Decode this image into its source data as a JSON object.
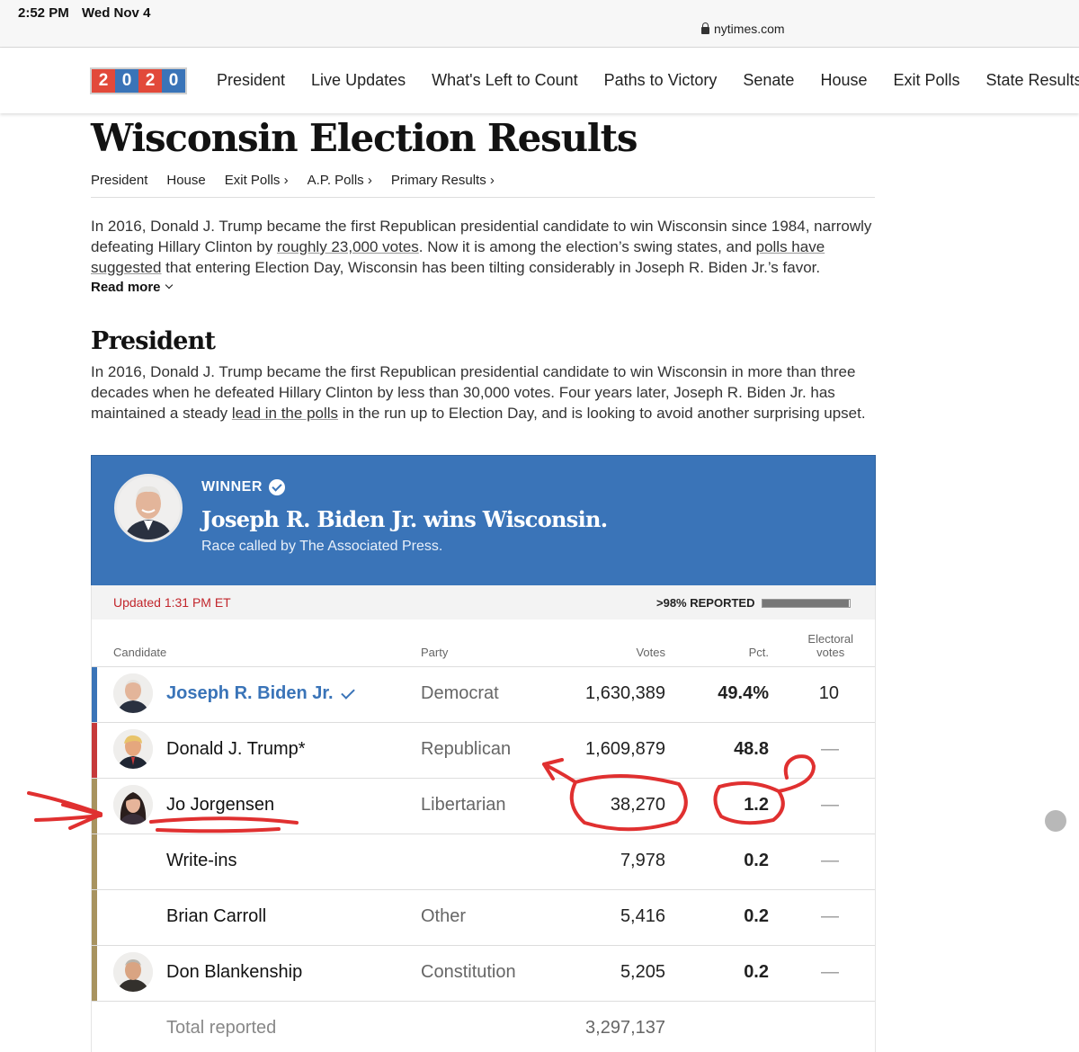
{
  "status": {
    "time": "2:52 PM",
    "date": "Wed Nov 4",
    "url": "nytimes.com"
  },
  "nav": {
    "logo": [
      "2",
      "0",
      "2",
      "0"
    ],
    "items": [
      "President",
      "Live Updates",
      "What's Left to Count",
      "Paths to Victory",
      "Senate",
      "House",
      "Exit Polls",
      "State Results"
    ]
  },
  "page": {
    "title": "Wisconsin Election Results",
    "subnav": [
      "President",
      "House",
      "Exit Polls ›",
      "A.P. Polls ›",
      "Primary Results ›"
    ],
    "intro": {
      "t1": "In 2016, Donald J. Trump became the first Republican presidential candidate to win Wisconsin since 1984, narrowly defeating Hillary Clinton by ",
      "link1": "roughly 23,000 votes",
      "t2": ". Now it is among the election’s swing states, and ",
      "link2": "polls have suggested",
      "t3": " that entering Election Day, Wisconsin has been tilting considerably in Joseph R. Biden Jr.’s favor."
    },
    "read_more": "Read more",
    "section_title": "President",
    "section_desc": {
      "t1": "In 2016, Donald J. Trump became the first Republican presidential candidate to win Wisconsin in more than three decades when he defeated Hillary Clinton by less than 30,000 votes. Four years later, Joseph R. Biden Jr. has maintained a steady ",
      "link": "lead in the polls",
      "t2": " in the run up to Election Day, and is looking to avoid another surprising upset."
    }
  },
  "winner": {
    "label": "WINNER",
    "headline": "Joseph R. Biden Jr. wins Wisconsin.",
    "sub": "Race called by The Associated Press."
  },
  "report": {
    "updated": "Updated 1:31 PM ET",
    "reported": ">98% REPORTED",
    "fraction": 0.98
  },
  "table": {
    "headers": {
      "candidate": "Candidate",
      "party": "Party",
      "votes": "Votes",
      "pct": "Pct.",
      "ev": "Electoral votes"
    },
    "rows": [
      {
        "name": "Joseph R. Biden Jr.",
        "party": "Democrat",
        "votes": "1,630,389",
        "pct": "49.4%",
        "ev": "10"
      },
      {
        "name": "Donald J. Trump*",
        "party": "Republican",
        "votes": "1,609,879",
        "pct": "48.8",
        "ev": "—"
      },
      {
        "name": "Jo Jorgensen",
        "party": "Libertarian",
        "votes": "38,270",
        "pct": "1.2",
        "ev": "—"
      },
      {
        "name": "Write-ins",
        "party": "",
        "votes": "7,978",
        "pct": "0.2",
        "ev": "—"
      },
      {
        "name": "Brian Carroll",
        "party": "Other",
        "votes": "5,416",
        "pct": "0.2",
        "ev": "—"
      },
      {
        "name": "Don Blankenship",
        "party": "Constitution",
        "votes": "5,205",
        "pct": "0.2",
        "ev": "—"
      }
    ],
    "total_label": "Total reported",
    "total_votes": "3,297,137"
  },
  "colors": {
    "dem": "#3a74b8",
    "rep": "#c6393a",
    "other": "#a8935f",
    "annotation": "#e03030"
  }
}
